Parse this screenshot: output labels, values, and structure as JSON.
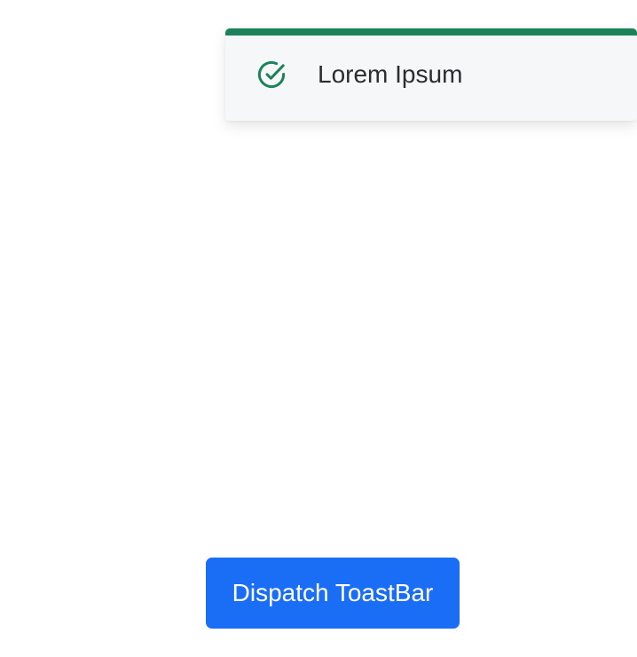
{
  "toast": {
    "message": "Lorem Ipsum",
    "icon": "check-circle-icon",
    "accent_color": "#1c8259",
    "background_color": "#f6f7f9"
  },
  "dispatch_button": {
    "label": "Dispatch ToastBar",
    "background_color": "#1a6ef5",
    "text_color": "#ffffff"
  }
}
